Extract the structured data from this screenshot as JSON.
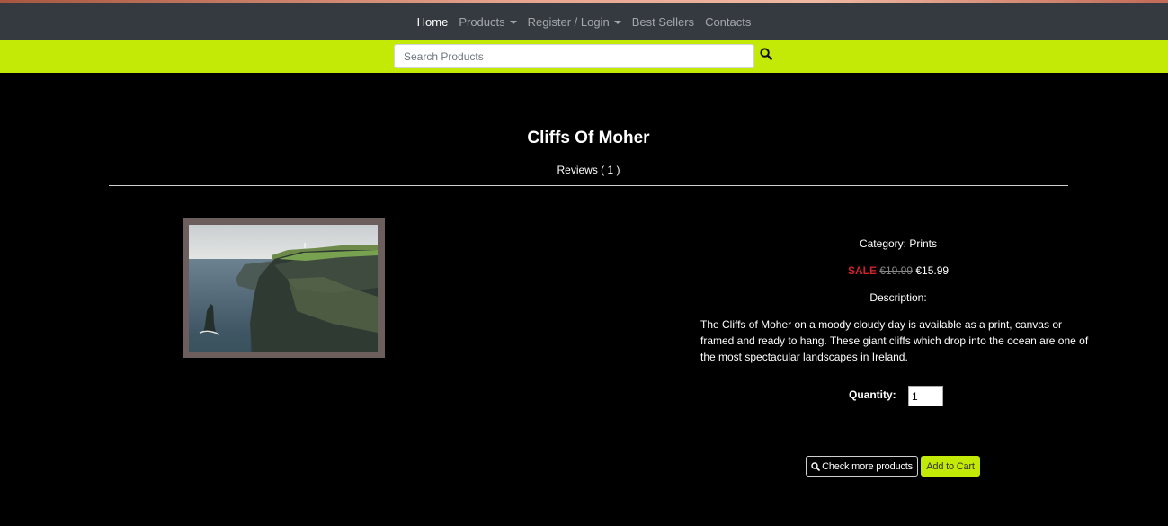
{
  "nav": {
    "items": [
      {
        "label": "Home",
        "active": true,
        "dropdown": false
      },
      {
        "label": "Products",
        "active": false,
        "dropdown": true
      },
      {
        "label": "Register / Login",
        "active": false,
        "dropdown": true
      },
      {
        "label": "Best Sellers",
        "active": false,
        "dropdown": false
      },
      {
        "label": "Contacts",
        "active": false,
        "dropdown": false
      }
    ]
  },
  "search": {
    "placeholder": "Search Products",
    "value": "",
    "icon": "search-icon"
  },
  "product": {
    "title": "Cliffs Of Moher",
    "reviews": "Reviews ( 1 )",
    "category": "Category: Prints",
    "sale_label": "SALE",
    "old_price": "€19.99",
    "price": "€15.99",
    "description_label": "Description:",
    "description": "The Cliffs of Moher on a moody cloudy day is available as a print, canvas or framed and ready to hang. These giant cliffs which drop into the ocean are one of the most spectacular landscapes in Ireland.",
    "image": "cliffs-of-moher-photo"
  },
  "quantity": {
    "label": "Quantity:",
    "value": "1"
  },
  "buttons": {
    "check_more": "Check more products",
    "add_to_cart": "Add to Cart"
  },
  "colors": {
    "navbar": "#343a40",
    "accent": "#c2ea06",
    "background": "#000000",
    "sale": "#d0242b"
  }
}
